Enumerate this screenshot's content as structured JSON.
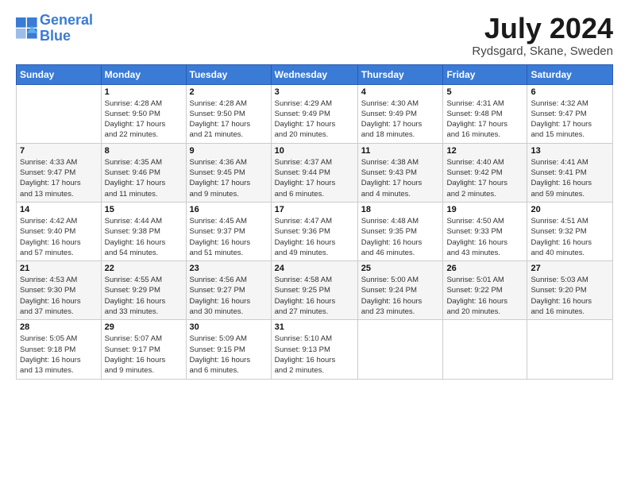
{
  "header": {
    "logo_line1": "General",
    "logo_line2": "Blue",
    "month_year": "July 2024",
    "location": "Rydsgard, Skane, Sweden"
  },
  "weekdays": [
    "Sunday",
    "Monday",
    "Tuesday",
    "Wednesday",
    "Thursday",
    "Friday",
    "Saturday"
  ],
  "weeks": [
    [
      {
        "day": "",
        "info": ""
      },
      {
        "day": "1",
        "info": "Sunrise: 4:28 AM\nSunset: 9:50 PM\nDaylight: 17 hours\nand 22 minutes."
      },
      {
        "day": "2",
        "info": "Sunrise: 4:28 AM\nSunset: 9:50 PM\nDaylight: 17 hours\nand 21 minutes."
      },
      {
        "day": "3",
        "info": "Sunrise: 4:29 AM\nSunset: 9:49 PM\nDaylight: 17 hours\nand 20 minutes."
      },
      {
        "day": "4",
        "info": "Sunrise: 4:30 AM\nSunset: 9:49 PM\nDaylight: 17 hours\nand 18 minutes."
      },
      {
        "day": "5",
        "info": "Sunrise: 4:31 AM\nSunset: 9:48 PM\nDaylight: 17 hours\nand 16 minutes."
      },
      {
        "day": "6",
        "info": "Sunrise: 4:32 AM\nSunset: 9:47 PM\nDaylight: 17 hours\nand 15 minutes."
      }
    ],
    [
      {
        "day": "7",
        "info": "Sunrise: 4:33 AM\nSunset: 9:47 PM\nDaylight: 17 hours\nand 13 minutes."
      },
      {
        "day": "8",
        "info": "Sunrise: 4:35 AM\nSunset: 9:46 PM\nDaylight: 17 hours\nand 11 minutes."
      },
      {
        "day": "9",
        "info": "Sunrise: 4:36 AM\nSunset: 9:45 PM\nDaylight: 17 hours\nand 9 minutes."
      },
      {
        "day": "10",
        "info": "Sunrise: 4:37 AM\nSunset: 9:44 PM\nDaylight: 17 hours\nand 6 minutes."
      },
      {
        "day": "11",
        "info": "Sunrise: 4:38 AM\nSunset: 9:43 PM\nDaylight: 17 hours\nand 4 minutes."
      },
      {
        "day": "12",
        "info": "Sunrise: 4:40 AM\nSunset: 9:42 PM\nDaylight: 17 hours\nand 2 minutes."
      },
      {
        "day": "13",
        "info": "Sunrise: 4:41 AM\nSunset: 9:41 PM\nDaylight: 16 hours\nand 59 minutes."
      }
    ],
    [
      {
        "day": "14",
        "info": "Sunrise: 4:42 AM\nSunset: 9:40 PM\nDaylight: 16 hours\nand 57 minutes."
      },
      {
        "day": "15",
        "info": "Sunrise: 4:44 AM\nSunset: 9:38 PM\nDaylight: 16 hours\nand 54 minutes."
      },
      {
        "day": "16",
        "info": "Sunrise: 4:45 AM\nSunset: 9:37 PM\nDaylight: 16 hours\nand 51 minutes."
      },
      {
        "day": "17",
        "info": "Sunrise: 4:47 AM\nSunset: 9:36 PM\nDaylight: 16 hours\nand 49 minutes."
      },
      {
        "day": "18",
        "info": "Sunrise: 4:48 AM\nSunset: 9:35 PM\nDaylight: 16 hours\nand 46 minutes."
      },
      {
        "day": "19",
        "info": "Sunrise: 4:50 AM\nSunset: 9:33 PM\nDaylight: 16 hours\nand 43 minutes."
      },
      {
        "day": "20",
        "info": "Sunrise: 4:51 AM\nSunset: 9:32 PM\nDaylight: 16 hours\nand 40 minutes."
      }
    ],
    [
      {
        "day": "21",
        "info": "Sunrise: 4:53 AM\nSunset: 9:30 PM\nDaylight: 16 hours\nand 37 minutes."
      },
      {
        "day": "22",
        "info": "Sunrise: 4:55 AM\nSunset: 9:29 PM\nDaylight: 16 hours\nand 33 minutes."
      },
      {
        "day": "23",
        "info": "Sunrise: 4:56 AM\nSunset: 9:27 PM\nDaylight: 16 hours\nand 30 minutes."
      },
      {
        "day": "24",
        "info": "Sunrise: 4:58 AM\nSunset: 9:25 PM\nDaylight: 16 hours\nand 27 minutes."
      },
      {
        "day": "25",
        "info": "Sunrise: 5:00 AM\nSunset: 9:24 PM\nDaylight: 16 hours\nand 23 minutes."
      },
      {
        "day": "26",
        "info": "Sunrise: 5:01 AM\nSunset: 9:22 PM\nDaylight: 16 hours\nand 20 minutes."
      },
      {
        "day": "27",
        "info": "Sunrise: 5:03 AM\nSunset: 9:20 PM\nDaylight: 16 hours\nand 16 minutes."
      }
    ],
    [
      {
        "day": "28",
        "info": "Sunrise: 5:05 AM\nSunset: 9:18 PM\nDaylight: 16 hours\nand 13 minutes."
      },
      {
        "day": "29",
        "info": "Sunrise: 5:07 AM\nSunset: 9:17 PM\nDaylight: 16 hours\nand 9 minutes."
      },
      {
        "day": "30",
        "info": "Sunrise: 5:09 AM\nSunset: 9:15 PM\nDaylight: 16 hours\nand 6 minutes."
      },
      {
        "day": "31",
        "info": "Sunrise: 5:10 AM\nSunset: 9:13 PM\nDaylight: 16 hours\nand 2 minutes."
      },
      {
        "day": "",
        "info": ""
      },
      {
        "day": "",
        "info": ""
      },
      {
        "day": "",
        "info": ""
      }
    ]
  ]
}
